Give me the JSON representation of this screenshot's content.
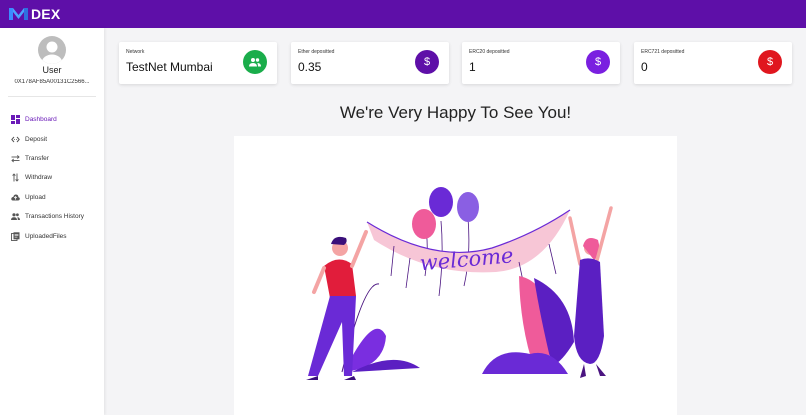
{
  "app": {
    "name": "DEX",
    "colors": {
      "brand": "#5e0fa8",
      "accent": "#6a1ab8"
    }
  },
  "user": {
    "name": "User",
    "address": "0X178AF85A00131C2566..."
  },
  "nav": {
    "items": [
      {
        "label": "Dashboard",
        "icon": "dashboard-icon",
        "active": true
      },
      {
        "label": "Deposit",
        "icon": "code-arrows-icon"
      },
      {
        "label": "Transfer",
        "icon": "swap-arrows-icon"
      },
      {
        "label": "Withdraw",
        "icon": "vertical-swap-icon"
      },
      {
        "label": "Upload",
        "icon": "cloud-upload-icon"
      },
      {
        "label": "Transactions History",
        "icon": "people-icon"
      },
      {
        "label": "UploadedFiles",
        "icon": "files-icon"
      }
    ]
  },
  "cards": [
    {
      "title": "Network",
      "value": "TestNet Mumbai",
      "icon": "people-icon",
      "color": "#1aad4b"
    },
    {
      "title": "Ether depositted",
      "value": "0.35",
      "icon": "dollar-icon",
      "color": "#5e0fa8"
    },
    {
      "title": "ERC20 depositted",
      "value": "1",
      "icon": "dollar-icon",
      "color": "#7a1fe0"
    },
    {
      "title": "ERC721 depositted",
      "value": "0",
      "icon": "dollar-icon",
      "color": "#e0161e"
    }
  ],
  "main": {
    "headline": "We're Very Happy To See You!",
    "banner_text": "welcome",
    "illustration": "welcome-party-illustration"
  }
}
